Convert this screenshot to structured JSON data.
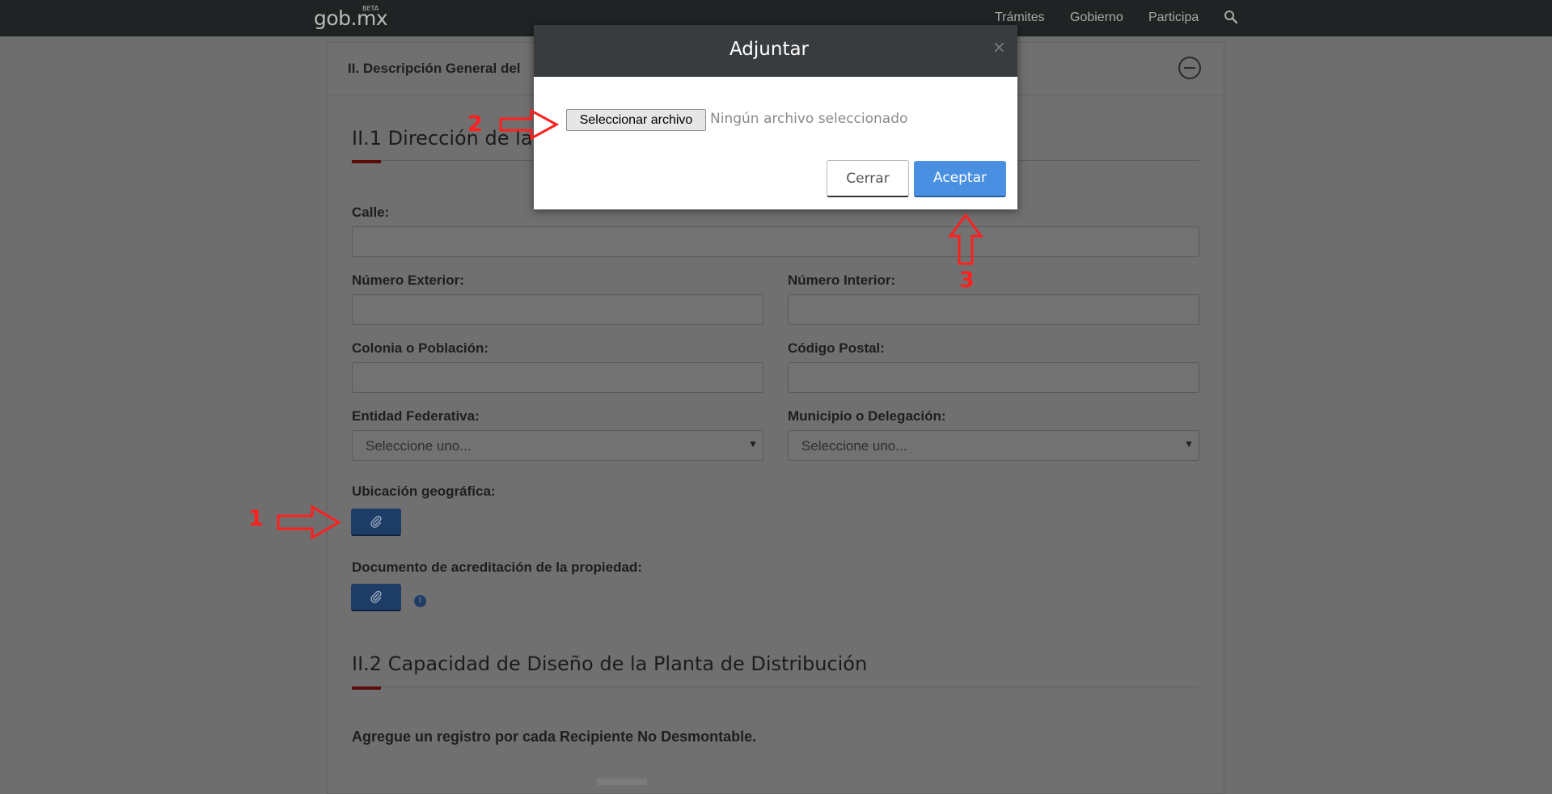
{
  "navbar": {
    "logo": "gob.mx",
    "logo_badge": "BETA",
    "links": [
      "Trámites",
      "Gobierno",
      "Participa"
    ],
    "search_icon": "search-icon"
  },
  "panel": {
    "title": "II. Descripción General del"
  },
  "section1": {
    "title": "II.1 Dirección de la P"
  },
  "form": {
    "calle_label": "Calle:",
    "num_ext_label": "Número Exterior:",
    "num_int_label": "Número Interior:",
    "colonia_label": "Colonia o Población:",
    "cp_label": "Código Postal:",
    "entidad_label": "Entidad Federativa:",
    "entidad_value": "Seleccione uno...",
    "municipio_label": "Municipio o Delegación:",
    "municipio_value": "Seleccione uno...",
    "ubicacion_label": "Ubicación geográfica:",
    "documento_label": "Documento de acreditación de la propiedad:",
    "info_glyph": "!"
  },
  "section2": {
    "title": "II.2 Capacidad de Diseño de la Planta de Distribución",
    "note": "Agregue un registro por cada Recipiente No Desmontable."
  },
  "modal": {
    "title": "Adjuntar",
    "close_glyph": "×",
    "file_button": "Seleccionar archivo",
    "file_status": "Ningún archivo seleccionado",
    "cancel": "Cerrar",
    "accept": "Aceptar"
  },
  "annotations": {
    "step1": "1",
    "step2": "2",
    "step3": "3",
    "color": "#ff2020"
  }
}
